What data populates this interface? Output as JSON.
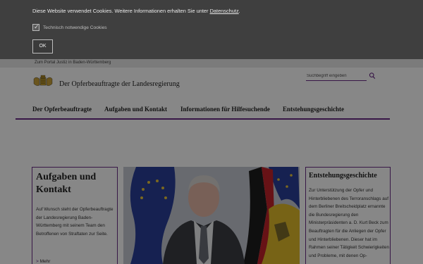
{
  "cookie": {
    "text": "Diese Website verwendet Cookies. Weitere Informationen erhalten Sie unter",
    "link": "Datenschutz",
    "suffix": ".",
    "checkbox_label": "Technisch notwendige Cookies",
    "ok_label": "OK"
  },
  "topbar": {
    "portal_link": "Zum Portal Justiz in Baden-Württemberg"
  },
  "header": {
    "title": "Der Opferbeauftragte der Landesregierung"
  },
  "search": {
    "placeholder": "Suchbegriff eingeben"
  },
  "nav": {
    "items": [
      {
        "label": "Der Opferbeauftragte"
      },
      {
        "label": "Aufgaben und Kontakt"
      },
      {
        "label": "Informationen für Hilfesuchende"
      },
      {
        "label": "Entstehungsgeschichte"
      }
    ]
  },
  "left_box": {
    "title": "Aufgaben und Kontakt",
    "text": "Auf Wunsch steht der Opferbeauftragte der Landesregierung Baden-Württemberg mit seinem Team den Betroffenen von Straftaten zur Seite.",
    "more": "Mehr"
  },
  "right_box": {
    "title": "Entstehungsgeschichte",
    "text": "Zur Unterstützung der Opfer und Hinterbliebenen des Terroranschlags auf dem Berliner Breitscheidplatz ernannte die Bundesregierung den Ministerpräsidenten a. D. Kurt Beck zum Beauftragten für die Anliegen der Opfer und Hinterbliebenen. Dieser hat im Rahmen seiner Tätigkeit Schwierigkeiten und Probleme, mit denen Op-"
  },
  "colors": {
    "accent": "#6b2c86",
    "overlay": "#3f3f3f"
  },
  "icons": {
    "search": "search-icon",
    "logo": "coat-of-arms-logo",
    "checkbox": "checkmark-icon",
    "more": "chevron-right-icon"
  }
}
